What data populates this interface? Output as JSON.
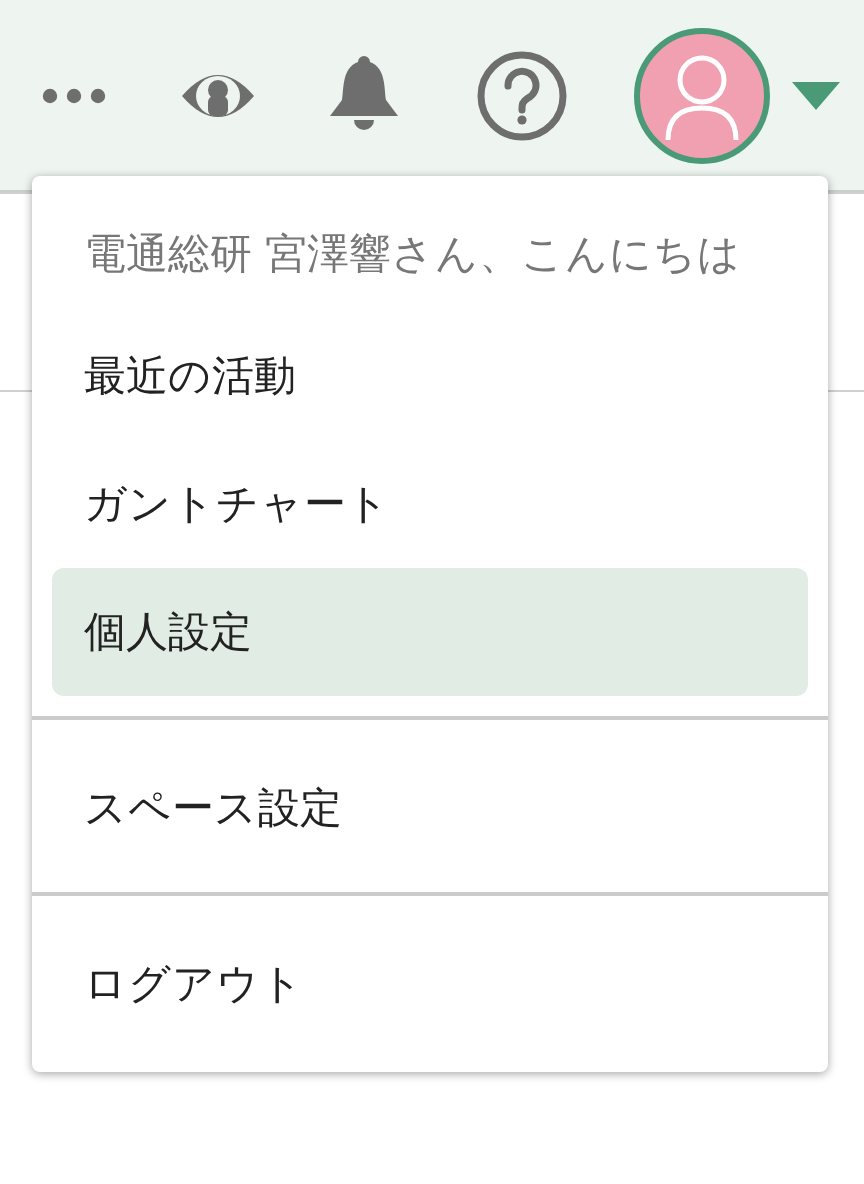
{
  "header": {
    "avatar_menu_open": true
  },
  "menu": {
    "greeting": "電通総研 宮澤響さん、こんにちは",
    "groups": [
      [
        {
          "label": "最近の活動",
          "selected": false
        },
        {
          "label": "ガントチャート",
          "selected": false
        },
        {
          "label": "個人設定",
          "selected": true
        }
      ],
      [
        {
          "label": "スペース設定",
          "selected": false
        }
      ],
      [
        {
          "label": "ログアウト",
          "selected": false
        }
      ]
    ]
  }
}
